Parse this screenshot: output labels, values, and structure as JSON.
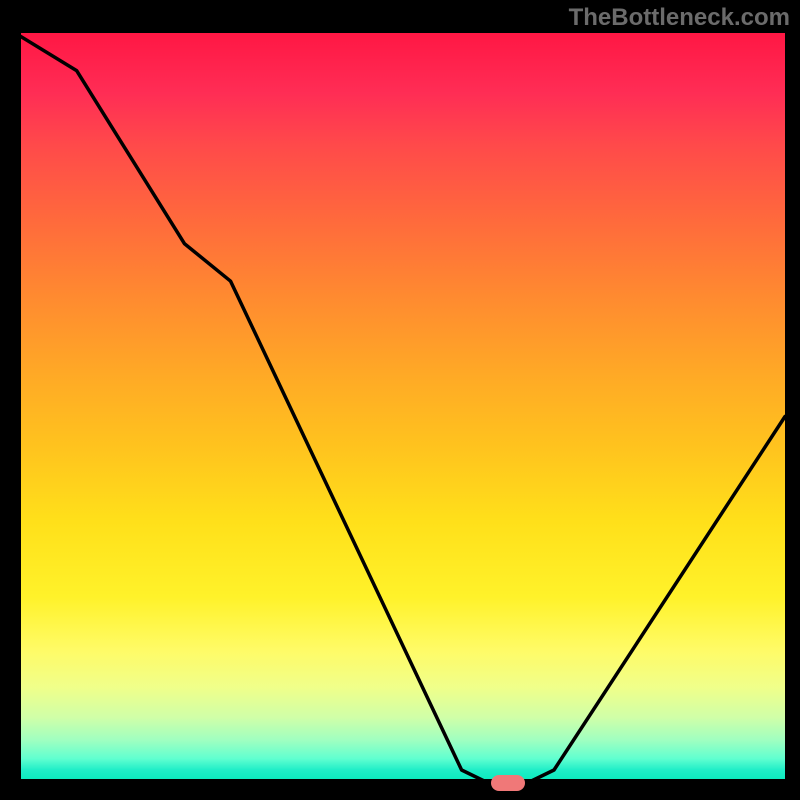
{
  "watermark": "TheBottleneck.com",
  "chart_data": {
    "type": "line",
    "title": "",
    "xlabel": "",
    "ylabel": "",
    "xlim": [
      0,
      100
    ],
    "ylim": [
      0,
      100
    ],
    "series": [
      {
        "name": "bottleneck-curve",
        "x": [
          0,
          8,
          22,
          28,
          58,
          62,
          66,
          70,
          100
        ],
        "values": [
          100,
          95,
          72,
          67,
          2,
          0,
          0,
          2,
          49
        ]
      }
    ],
    "marker": {
      "x": 64,
      "y": 0
    },
    "gradient_stops": [
      {
        "pos": 0,
        "color": "#ff1744"
      },
      {
        "pos": 25,
        "color": "#ff6a3c"
      },
      {
        "pos": 55,
        "color": "#ffc31e"
      },
      {
        "pos": 82,
        "color": "#fffb66"
      },
      {
        "pos": 100,
        "color": "#00e8b8"
      }
    ]
  }
}
